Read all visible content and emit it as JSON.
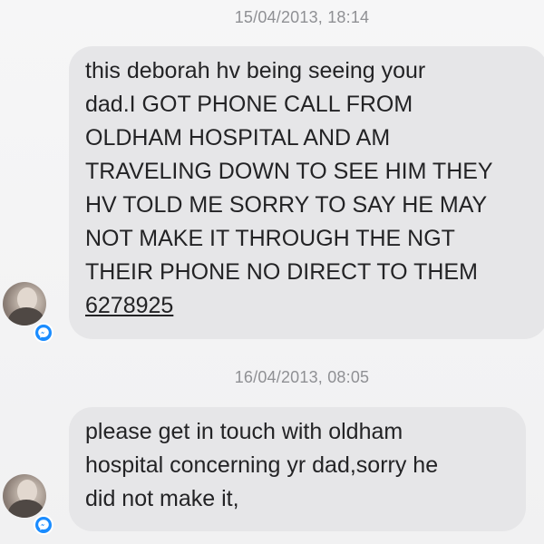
{
  "messages": [
    {
      "timestamp": "15/04/2013, 18:14",
      "lines": [
        "this deborah hv being seeing your",
        "dad.I GOT PHONE CALL FROM",
        "OLDHAM HOSPITAL AND AM",
        "TRAVELING DOWN TO SEE HIM THEY",
        "HV TOLD ME SORRY TO SAY HE MAY",
        "NOT MAKE IT THROUGH THE NGT",
        "THEIR PHONE NO DIRECT TO THEM"
      ],
      "phone": "6278925"
    },
    {
      "timestamp": "16/04/2013, 08:05",
      "lines": [
        "please get in touch with oldham",
        "hospital concerning yr dad,sorry he",
        "did not make it,"
      ]
    }
  ],
  "icons": {
    "avatar": "avatar-icon",
    "badge": "messenger-icon"
  },
  "colors": {
    "bubble": "#e6e6e8",
    "badge": "#1a8cff",
    "timestamp": "#8f9094"
  }
}
